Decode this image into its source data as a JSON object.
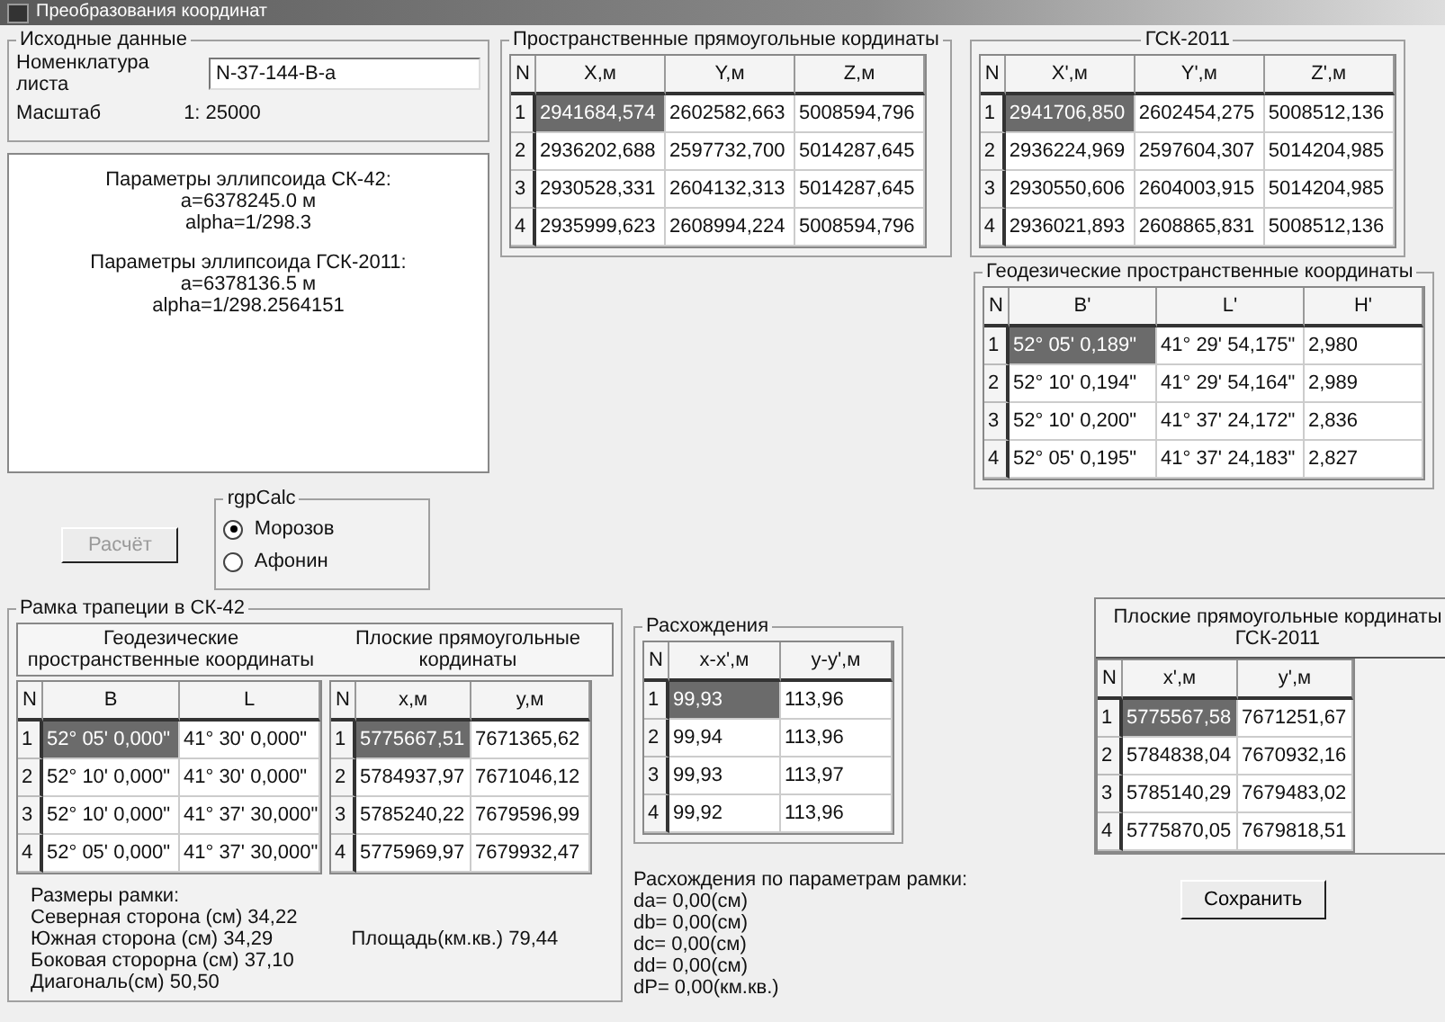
{
  "window": {
    "title": "Преобразования координат"
  },
  "source": {
    "title": "Исходные данные",
    "sheet_label": "Номенклатура листа",
    "sheet_value": "N-37-144-В-а",
    "scale_label": "Масштаб",
    "scale_value": "1: 25000"
  },
  "ellipsoid_info": [
    {
      "lines": [
        "Параметры эллипсоида СК-42:",
        "a=6378245.0 м",
        "alpha=1/298.3"
      ]
    },
    {
      "lines": [
        "Параметры эллипсоида ГСК-2011:",
        "a=6378136.5 м",
        "alpha=1/298.2564151"
      ]
    }
  ],
  "calc_button": {
    "label": "Расчёт",
    "disabled": true
  },
  "method_group": {
    "title": "rgpCalc",
    "options": [
      {
        "label": "Морозов",
        "selected": true
      },
      {
        "label": "Афонин",
        "selected": false
      }
    ]
  },
  "spatial_sk42": {
    "title": "Пространственные прямоугольные кординаты",
    "columns": [
      "N",
      "X,м",
      "Y,м",
      "Z,м"
    ],
    "rows": [
      {
        "cells": [
          {
            "text": "1",
            "selected": false
          },
          {
            "text": "2941684,574",
            "selected": true
          },
          {
            "text": "2602582,663",
            "selected": false
          },
          {
            "text": "5008594,796",
            "selected": false
          }
        ]
      },
      {
        "cells": [
          {
            "text": "2",
            "selected": false
          },
          {
            "text": "2936202,688",
            "selected": false
          },
          {
            "text": "2597732,700",
            "selected": false
          },
          {
            "text": "5014287,645",
            "selected": false
          }
        ]
      },
      {
        "cells": [
          {
            "text": "3",
            "selected": false
          },
          {
            "text": "2930528,331",
            "selected": false
          },
          {
            "text": "2604132,313",
            "selected": false
          },
          {
            "text": "5014287,645",
            "selected": false
          }
        ]
      },
      {
        "cells": [
          {
            "text": "4",
            "selected": false
          },
          {
            "text": "2935999,623",
            "selected": false
          },
          {
            "text": "2608994,224",
            "selected": false
          },
          {
            "text": "5008594,796",
            "selected": false
          }
        ]
      }
    ]
  },
  "spatial_gsk": {
    "title": "ГСК-2011",
    "columns": [
      "N",
      "X',м",
      "Y',м",
      "Z',м"
    ],
    "rows": [
      {
        "cells": [
          {
            "text": "1",
            "selected": false
          },
          {
            "text": "2941706,850",
            "selected": true
          },
          {
            "text": "2602454,275",
            "selected": false
          },
          {
            "text": "5008512,136",
            "selected": false
          }
        ]
      },
      {
        "cells": [
          {
            "text": "2",
            "selected": false
          },
          {
            "text": "2936224,969",
            "selected": false
          },
          {
            "text": "2597604,307",
            "selected": false
          },
          {
            "text": "5014204,985",
            "selected": false
          }
        ]
      },
      {
        "cells": [
          {
            "text": "3",
            "selected": false
          },
          {
            "text": "2930550,606",
            "selected": false
          },
          {
            "text": "2604003,915",
            "selected": false
          },
          {
            "text": "5014204,985",
            "selected": false
          }
        ]
      },
      {
        "cells": [
          {
            "text": "4",
            "selected": false
          },
          {
            "text": "2936021,893",
            "selected": false
          },
          {
            "text": "2608865,831",
            "selected": false
          },
          {
            "text": "5008512,136",
            "selected": false
          }
        ]
      }
    ]
  },
  "geodetic_gsk": {
    "title": "Геодезические пространственные координаты",
    "columns": [
      "N",
      "B'",
      "L'",
      "H'"
    ],
    "rows": [
      {
        "cells": [
          {
            "text": "1",
            "selected": false
          },
          {
            "text": "52° 05' 0,189\"",
            "selected": true
          },
          {
            "text": "41° 29' 54,175\"",
            "selected": false
          },
          {
            "text": "2,980",
            "selected": false
          }
        ]
      },
      {
        "cells": [
          {
            "text": "2",
            "selected": false
          },
          {
            "text": "52° 10' 0,194\"",
            "selected": false
          },
          {
            "text": "41° 29' 54,164\"",
            "selected": false
          },
          {
            "text": "2,989",
            "selected": false
          }
        ]
      },
      {
        "cells": [
          {
            "text": "3",
            "selected": false
          },
          {
            "text": "52° 10' 0,200\"",
            "selected": false
          },
          {
            "text": "41° 37' 24,172\"",
            "selected": false
          },
          {
            "text": "2,836",
            "selected": false
          }
        ]
      },
      {
        "cells": [
          {
            "text": "4",
            "selected": false
          },
          {
            "text": "52° 05' 0,195\"",
            "selected": false
          },
          {
            "text": "41° 37' 24,183\"",
            "selected": false
          },
          {
            "text": "2,827",
            "selected": false
          }
        ]
      }
    ]
  },
  "frame_sk42": {
    "title": "Рамка трапеции в СК-42",
    "geodetic_caption": "Геодезические пространственные координаты",
    "plane_caption": "Плоские прямоугольные кординаты",
    "geodetic_table": {
      "columns": [
        "N",
        "B",
        "L"
      ],
      "rows": [
        {
          "cells": [
            {
              "text": "1",
              "selected": false
            },
            {
              "text": "52° 05' 0,000\"",
              "selected": true
            },
            {
              "text": "41° 30' 0,000\"",
              "selected": false
            }
          ]
        },
        {
          "cells": [
            {
              "text": "2",
              "selected": false
            },
            {
              "text": "52° 10' 0,000\"",
              "selected": false
            },
            {
              "text": "41° 30' 0,000\"",
              "selected": false
            }
          ]
        },
        {
          "cells": [
            {
              "text": "3",
              "selected": false
            },
            {
              "text": "52° 10' 0,000\"",
              "selected": false
            },
            {
              "text": "41° 37' 30,000\"",
              "selected": false
            }
          ]
        },
        {
          "cells": [
            {
              "text": "4",
              "selected": false
            },
            {
              "text": "52° 05' 0,000\"",
              "selected": false
            },
            {
              "text": "41° 37' 30,000\"",
              "selected": false
            }
          ]
        }
      ]
    },
    "plane_table": {
      "columns": [
        "N",
        "x,м",
        "y,м"
      ],
      "rows": [
        {
          "cells": [
            {
              "text": "1",
              "selected": false
            },
            {
              "text": "5775667,51",
              "selected": true
            },
            {
              "text": "7671365,62",
              "selected": false
            }
          ]
        },
        {
          "cells": [
            {
              "text": "2",
              "selected": false
            },
            {
              "text": "5784937,97",
              "selected": false
            },
            {
              "text": "7671046,12",
              "selected": false
            }
          ]
        },
        {
          "cells": [
            {
              "text": "3",
              "selected": false
            },
            {
              "text": "5785240,22",
              "selected": false
            },
            {
              "text": "7679596,99",
              "selected": false
            }
          ]
        },
        {
          "cells": [
            {
              "text": "4",
              "selected": false
            },
            {
              "text": "5775969,97",
              "selected": false
            },
            {
              "text": "7679932,47",
              "selected": false
            }
          ]
        }
      ]
    },
    "sizes": [
      "Размеры рамки:",
      "Северная сторона (см) 34,22",
      "Южная сторона (см) 34,29",
      "Боковая сторорна (см) 37,10",
      "Диагональ(см) 50,50"
    ],
    "area": "Площадь(км.кв.) 79,44"
  },
  "differences": {
    "title": "Расхождения",
    "table": {
      "columns": [
        "N",
        "x-x',м",
        "y-y',м"
      ],
      "rows": [
        {
          "cells": [
            {
              "text": "1",
              "selected": false
            },
            {
              "text": "99,93",
              "selected": true
            },
            {
              "text": "113,96",
              "selected": false
            }
          ]
        },
        {
          "cells": [
            {
              "text": "2",
              "selected": false
            },
            {
              "text": "99,94",
              "selected": false
            },
            {
              "text": "113,96",
              "selected": false
            }
          ]
        },
        {
          "cells": [
            {
              "text": "3",
              "selected": false
            },
            {
              "text": "99,93",
              "selected": false
            },
            {
              "text": "113,97",
              "selected": false
            }
          ]
        },
        {
          "cells": [
            {
              "text": "4",
              "selected": false
            },
            {
              "text": "99,92",
              "selected": false
            },
            {
              "text": "113,96",
              "selected": false
            }
          ]
        }
      ]
    },
    "frame_lines": [
      "Расхождения по параметрам рамки:",
      "da= 0,00(см)",
      "db= 0,00(см)",
      "dc= 0,00(см)",
      "dd= 0,00(см)",
      "dP= 0,00(км.кв.)"
    ]
  },
  "plane_gsk": {
    "caption": "Плоские прямоугольные кординаты ГСК-2011",
    "table": {
      "columns": [
        "N",
        "x',м",
        "y',м"
      ],
      "rows": [
        {
          "cells": [
            {
              "text": "1",
              "selected": false
            },
            {
              "text": "5775567,58",
              "selected": true
            },
            {
              "text": "7671251,67",
              "selected": false
            }
          ]
        },
        {
          "cells": [
            {
              "text": "2",
              "selected": false
            },
            {
              "text": "5784838,04",
              "selected": false
            },
            {
              "text": "7670932,16",
              "selected": false
            }
          ]
        },
        {
          "cells": [
            {
              "text": "3",
              "selected": false
            },
            {
              "text": "5785140,29",
              "selected": false
            },
            {
              "text": "7679483,02",
              "selected": false
            }
          ]
        },
        {
          "cells": [
            {
              "text": "4",
              "selected": false
            },
            {
              "text": "5775870,05",
              "selected": false
            },
            {
              "text": "7679818,51",
              "selected": false
            }
          ]
        }
      ]
    }
  },
  "save_button": {
    "label": "Сохранить"
  }
}
